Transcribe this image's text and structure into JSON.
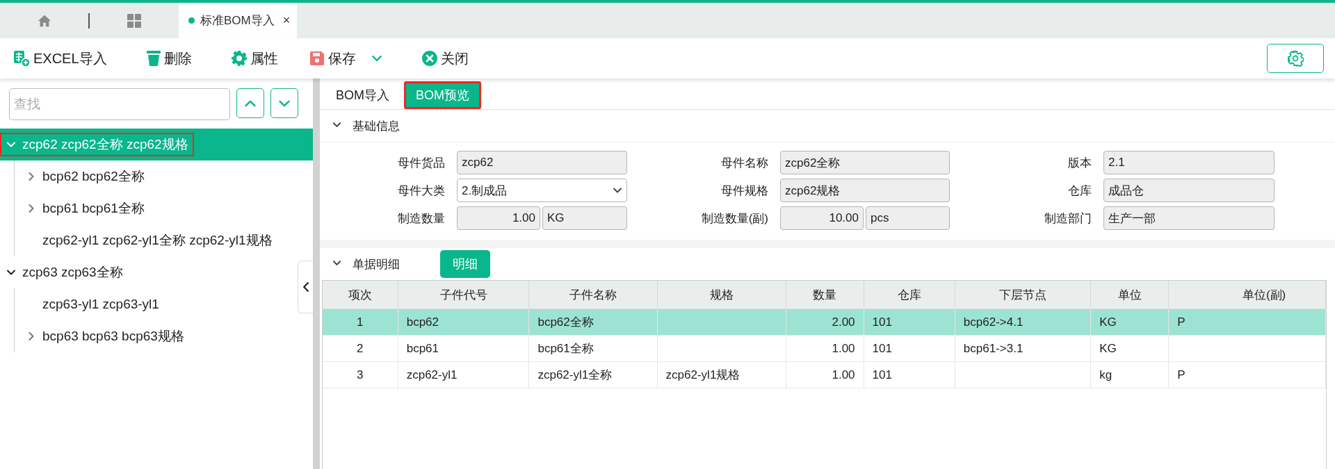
{
  "app_tabs": [
    {
      "kind": "home",
      "selected": false
    },
    {
      "kind": "apps",
      "selected": false
    },
    {
      "kind": "page",
      "label": "标准BOM导入",
      "close": "×",
      "selected": true
    }
  ],
  "toolbar": {
    "buttons": [
      {
        "kind": "excel",
        "label": "EXCEL导入",
        "dropdown": false
      },
      {
        "kind": "delete",
        "label": "删除",
        "dropdown": false
      },
      {
        "kind": "properties",
        "label": "属性",
        "dropdown": false
      },
      {
        "kind": "save",
        "label": "保存",
        "dropdown": true
      },
      {
        "kind": "close",
        "label": "关闭",
        "dropdown": false
      }
    ]
  },
  "sidebar": {
    "search": {
      "placeholder": "查找"
    },
    "tree": [
      {
        "label": "zcp62 zcp62全称 zcp62规格",
        "expandable": true,
        "expanded": true,
        "selected": true,
        "highlighted": true,
        "children": [
          {
            "label": "bcp62 bcp62全称",
            "expandable": true,
            "expanded": false,
            "selected": false,
            "highlighted": false
          },
          {
            "label": "bcp61 bcp61全称",
            "expandable": true,
            "expanded": false,
            "selected": false,
            "highlighted": false
          },
          {
            "label": "zcp62-yl1 zcp62-yl1全称 zcp62-yl1规格",
            "expandable": false,
            "expanded": false,
            "selected": false,
            "highlighted": false
          }
        ]
      },
      {
        "label": "zcp63 zcp63全称",
        "expandable": true,
        "expanded": true,
        "selected": false,
        "highlighted": false,
        "children": [
          {
            "label": "zcp63-yl1 zcp63-yl1",
            "expandable": false,
            "expanded": false,
            "selected": false,
            "highlighted": false
          },
          {
            "label": "bcp63 bcp63 bcp63规格",
            "expandable": true,
            "expanded": false,
            "selected": false,
            "highlighted": false
          }
        ]
      }
    ]
  },
  "view_tabs": [
    {
      "label": "BOM导入",
      "selected": false,
      "highlighted": false
    },
    {
      "label": "BOM预览",
      "selected": true,
      "highlighted": true
    }
  ],
  "basic_info": {
    "title": "基础信息",
    "expanded": true,
    "fields": [
      {
        "label": "母件货品",
        "kind": "text",
        "value": "zcp62"
      },
      {
        "label": "母件名称",
        "kind": "text",
        "value": "zcp62全称"
      },
      {
        "label": "版本",
        "kind": "text",
        "value": "2.1"
      },
      {
        "label": "母件大类",
        "kind": "select",
        "value": "2.制成品"
      },
      {
        "label": "母件规格",
        "kind": "text",
        "value": "zcp62规格"
      },
      {
        "label": "仓库",
        "kind": "text",
        "value": "成品仓"
      },
      {
        "label": "制造数量",
        "kind": "quantity",
        "value": "1.00",
        "unit": "KG"
      },
      {
        "label": "制造数量(副)",
        "kind": "quantity",
        "value": "10.00",
        "unit": "pcs"
      },
      {
        "label": "制造部门",
        "kind": "text",
        "value": "生产一部"
      }
    ]
  },
  "details": {
    "title": "单据明细",
    "expanded": true,
    "button": "明细",
    "table": {
      "columns": [
        "项次",
        "子件代号",
        "子件名称",
        "规格",
        "数量",
        "仓库",
        "下层节点",
        "单位",
        "单位(副)"
      ],
      "rows": [
        {
          "selected": true,
          "cells": [
            "1",
            "bcp62",
            "bcp62全称",
            "",
            "2.00",
            "101",
            "bcp62->4.1",
            "KG",
            "P"
          ]
        },
        {
          "selected": false,
          "cells": [
            "2",
            "bcp61",
            "bcp61全称",
            "",
            "1.00",
            "101",
            "bcp61->3.1",
            "KG",
            ""
          ]
        },
        {
          "selected": false,
          "cells": [
            "3",
            "zcp62-yl1",
            "zcp62-yl1全称",
            "zcp62-yl1规格",
            "1.00",
            "101",
            "",
            "kg",
            "P"
          ]
        }
      ]
    }
  }
}
